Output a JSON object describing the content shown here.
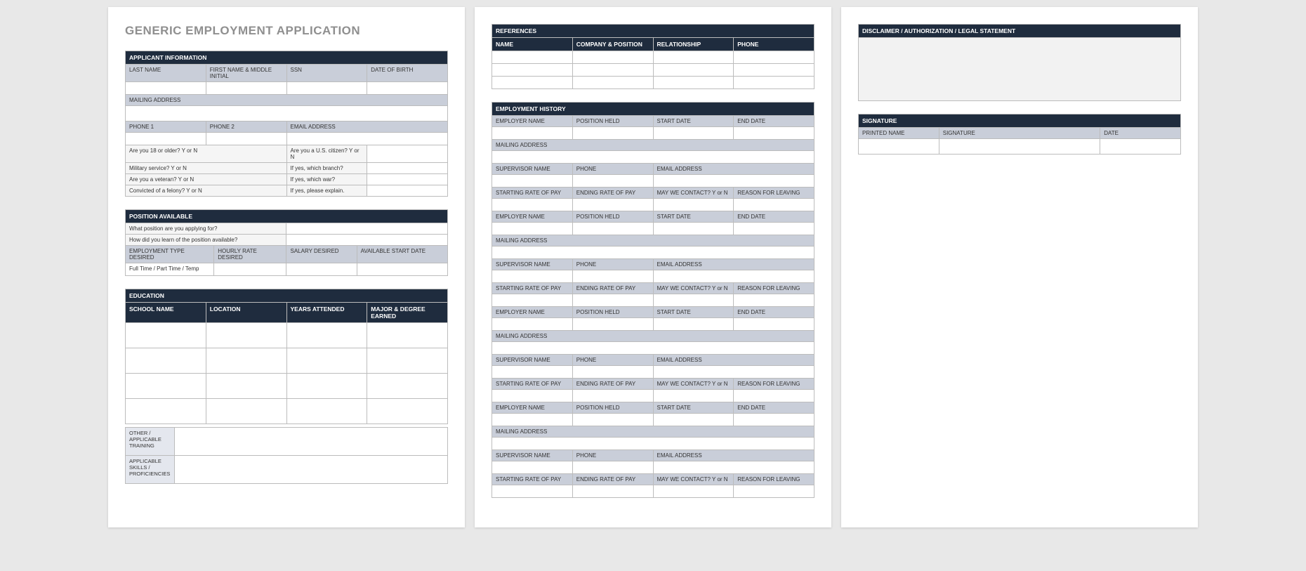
{
  "title": "GENERIC EMPLOYMENT APPLICATION",
  "applicant": {
    "header": "APPLICANT INFORMATION",
    "last_name": "LAST NAME",
    "first_mi": "FIRST NAME & MIDDLE INITIAL",
    "ssn": "SSN",
    "dob": "DATE OF BIRTH",
    "mailing": "MAILING ADDRESS",
    "phone1": "PHONE 1",
    "phone2": "PHONE 2",
    "email": "EMAIL ADDRESS",
    "q18": "Are you 18 or older?  Y or N",
    "qcitizen": "Are you a U.S. citizen?  Y or N",
    "qmilitary": "Military service?  Y or N",
    "qbranch": "If yes, which branch?",
    "qveteran": "Are you a veteran?  Y or N",
    "qwar": "If yes, which war?",
    "qfelony": "Convicted of a felony?  Y or N",
    "qexplain": "If yes, please explain."
  },
  "position": {
    "header": "POSITION AVAILABLE",
    "q_applying": "What position are you applying for?",
    "q_learn": "How did you learn of the position available?",
    "emp_type": "EMPLOYMENT TYPE DESIRED",
    "hourly": "HOURLY RATE DESIRED",
    "salary": "SALARY DESIRED",
    "avail_start": "AVAILABLE START DATE",
    "ftpt": "Full Time / Part Time / Temp"
  },
  "education": {
    "header": "EDUCATION",
    "school": "SCHOOL NAME",
    "location": "LOCATION",
    "years": "YEARS ATTENDED",
    "major": "MAJOR & DEGREE EARNED",
    "other_training": "OTHER / APPLICABLE TRAINING",
    "skills": "APPLICABLE SKILLS / PROFICIENCIES"
  },
  "references": {
    "header": "REFERENCES",
    "name": "NAME",
    "company": "COMPANY & POSITION",
    "relationship": "RELATIONSHIP",
    "phone": "PHONE"
  },
  "employment": {
    "header": "EMPLOYMENT HISTORY",
    "employer": "EMPLOYER NAME",
    "position_held": "POSITION HELD",
    "start_date": "START DATE",
    "end_date": "END DATE",
    "mailing": "MAILING ADDRESS",
    "supervisor": "SUPERVISOR NAME",
    "phone": "PHONE",
    "email": "EMAIL ADDRESS",
    "start_pay": "STARTING RATE OF PAY",
    "end_pay": "ENDING RATE OF PAY",
    "contact": "MAY WE CONTACT? Y or N",
    "reason": "REASON FOR LEAVING"
  },
  "disclaimer": {
    "header": "DISCLAIMER / AUTHORIZATION / LEGAL STATEMENT"
  },
  "signature": {
    "header": "SIGNATURE",
    "printed": "PRINTED NAME",
    "sign": "SIGNATURE",
    "date": "DATE"
  }
}
